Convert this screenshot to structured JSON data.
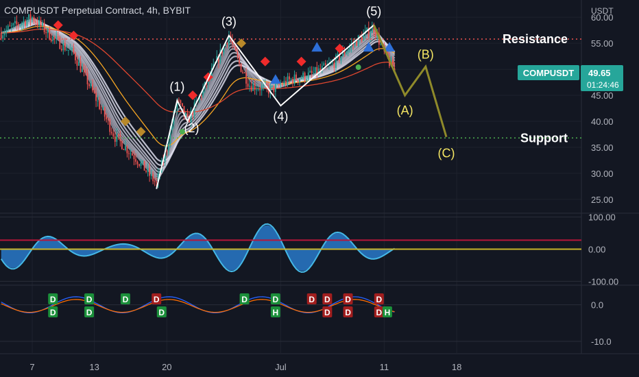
{
  "header": {
    "title": "COMPUSDT Perpetual Contract, 4h, BYBIT",
    "currency": "USDT"
  },
  "price_badge": {
    "symbol": "COMPUSDT",
    "price": "49.65",
    "countdown": "01:24:46",
    "color": "#26a69a"
  },
  "colors": {
    "background": "#131722",
    "up_candle": "#26a69a",
    "down_candle": "#ef5350",
    "resistance": "#ef5350",
    "support": "#4caf50",
    "projection": "#8f8a2a",
    "wave_labels_main": "#ffffff",
    "wave_labels_corrective": "#f5e663",
    "osc_blue": "#2b7fd4",
    "osc_cyan": "#45b8e6"
  },
  "chart_data": [
    {
      "type": "candlestick",
      "title": "COMPUSDT Perpetual Contract, 4h, BYBIT",
      "x_ticks": [
        "7",
        "13",
        "20",
        "Jul",
        "11",
        "18"
      ],
      "y_ticks": [
        "60.00",
        "55.00",
        "50.00",
        "45.00",
        "40.00",
        "35.00",
        "30.00",
        "25.00"
      ],
      "ylim": [
        23,
        62
      ],
      "price_path": [
        {
          "x": "Jun 4",
          "y": 57
        },
        {
          "x": "Jun 6",
          "y": 59
        },
        {
          "x": "Jun 7",
          "y": 60
        },
        {
          "x": "Jun 9",
          "y": 56
        },
        {
          "x": "Jun 11",
          "y": 53
        },
        {
          "x": "Jun 13",
          "y": 45
        },
        {
          "x": "Jun 15",
          "y": 37
        },
        {
          "x": "Jun 17",
          "y": 33
        },
        {
          "x": "Jun 19",
          "y": 28
        },
        {
          "x": "Jun 20",
          "y": 35
        },
        {
          "x": "Jun 21",
          "y": 44
        },
        {
          "x": "Jun 22",
          "y": 40
        },
        {
          "x": "Jun 24",
          "y": 48
        },
        {
          "x": "Jun 26",
          "y": 56.5
        },
        {
          "x": "Jun 27",
          "y": 51
        },
        {
          "x": "Jun 28",
          "y": 47
        },
        {
          "x": "Jun 30",
          "y": 46
        },
        {
          "x": "Jul 2",
          "y": 48
        },
        {
          "x": "Jul 4",
          "y": 49
        },
        {
          "x": "Jul 6",
          "y": 51
        },
        {
          "x": "Jul 8",
          "y": 55
        },
        {
          "x": "Jul 10",
          "y": 58
        },
        {
          "x": "Jul 11",
          "y": 53
        },
        {
          "x": "Jul 12",
          "y": 49.65
        }
      ],
      "levels": [
        {
          "name": "Resistance",
          "value": 55.8
        },
        {
          "name": "Support",
          "value": 36.8
        }
      ],
      "elliott_waves": [
        {
          "label": "(1)",
          "x": "Jun 21",
          "y": 44
        },
        {
          "label": "(2)",
          "x": "Jun 22",
          "y": 40
        },
        {
          "label": "(3)",
          "x": "Jun 26",
          "y": 56.5
        },
        {
          "label": "(4)",
          "x": "Jul 1",
          "y": 43
        },
        {
          "label": "(5)",
          "x": "Jul 10",
          "y": 58.5
        }
      ],
      "projection": [
        {
          "label": "(A)",
          "x": "Jul 13",
          "y": 45
        },
        {
          "label": "(B)",
          "x": "Jul 15",
          "y": 50.5
        },
        {
          "label": "(C)",
          "x": "Jul 17",
          "y": 37
        }
      ]
    },
    {
      "type": "area",
      "name": "oscillator",
      "y_ticks": [
        "100.00",
        "0.00",
        "-100.00"
      ],
      "ylim": [
        -110,
        110
      ]
    },
    {
      "type": "line",
      "name": "momentum",
      "y_ticks": [
        "0.0",
        "-10.0"
      ],
      "ylim": [
        -13,
        5
      ],
      "markers": [
        {
          "text": "D",
          "color": "green"
        },
        {
          "text": "H",
          "color": "red"
        }
      ]
    }
  ]
}
